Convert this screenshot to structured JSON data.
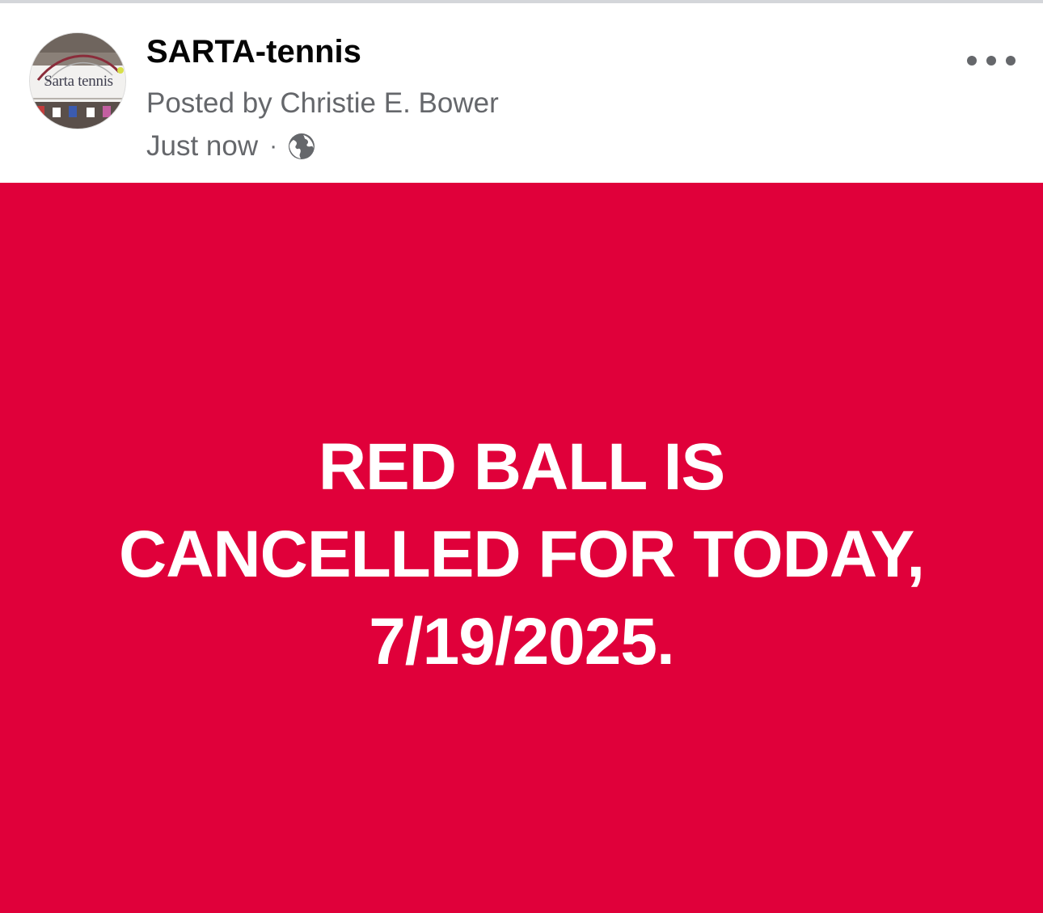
{
  "colors": {
    "post_background": "#e0003a",
    "post_text": "#ffffff",
    "meta_text": "#65676b",
    "name_text": "#050505"
  },
  "header": {
    "avatar_label": "Sarta tennis",
    "page_name": "SARTA-tennis",
    "posted_by": "Posted by Christie E. Bower",
    "timestamp": "Just now",
    "separator": "·",
    "privacy_icon": "globe-icon",
    "more_icon": "more-options-icon"
  },
  "post": {
    "lines": [
      "RED BALL IS",
      "CANCELLED FOR TODAY,",
      "7/19/2025."
    ]
  }
}
